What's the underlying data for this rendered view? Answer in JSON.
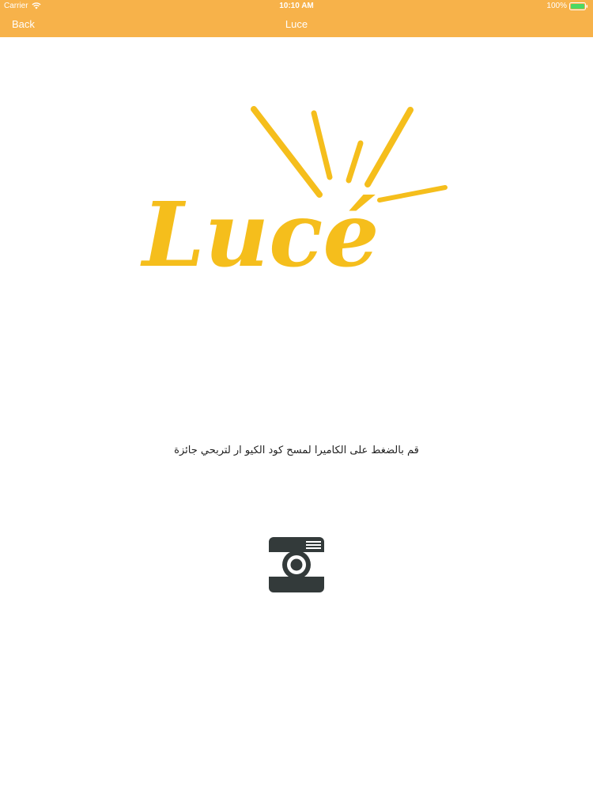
{
  "status_bar": {
    "carrier": "Carrier",
    "time": "10:10 AM",
    "battery": "100%",
    "wifi_icon": "wifi-icon",
    "battery_icon": "battery-icon",
    "battery_color": "#4cd964"
  },
  "nav": {
    "back_label": "Back",
    "title": "Luce",
    "bar_color": "#f7b24a"
  },
  "logo": {
    "text": "Lucé",
    "color": "#f5be1c"
  },
  "instruction": "قم بالضغط على الكاميرا لمسح كود الكيو ار لتربحي جائزة",
  "camera": {
    "icon": "camera-icon",
    "color": "#333a3a"
  }
}
